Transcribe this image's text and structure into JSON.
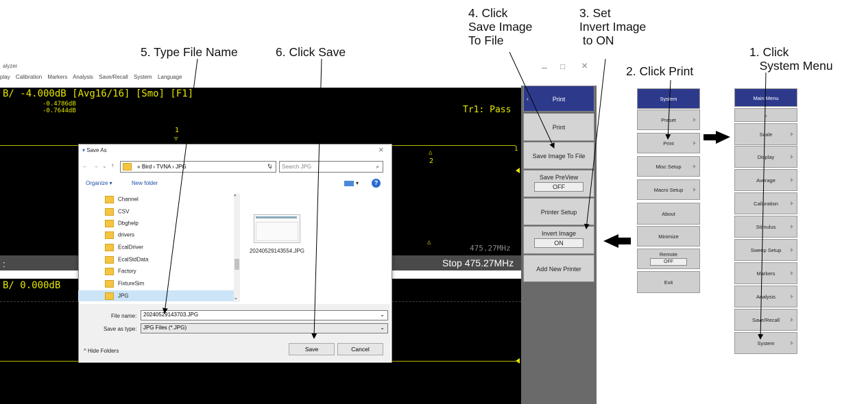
{
  "callouts": {
    "step1": "1. Click\n   System Menu",
    "step2": "2. Click Print",
    "step3": "3. Set\nInvert Image\n to ON",
    "step4": "4. Click\nSave Image\nTo File",
    "step5": "5. Type File Name",
    "step6": "6. Click Save"
  },
  "app": {
    "title": "alyzer",
    "menus": [
      "play",
      "Calibration",
      "Markers",
      "Analysis",
      "Save/Recall",
      "System",
      "Language"
    ],
    "window_controls": {
      "minimize": "–",
      "maximize": "□",
      "close": "×"
    }
  },
  "trace1": {
    "header": "B/ -4.000dB [Avg16/16] [Smo]   [F1]",
    "marker_val1": "-0.4786dB",
    "marker_val2": "-0.7644dB",
    "marker1_label": "1",
    "marker2_label": "2",
    "pass_label": "Tr1: Pass",
    "freq_label": "475.27MHz",
    "start_label": ":",
    "stop_label": "Stop 475.27MHz"
  },
  "trace2": {
    "header": "B/ 0.000dB"
  },
  "print_menu": {
    "title": "Print",
    "items": [
      {
        "label": "Print"
      },
      {
        "label": "Save Image To File"
      },
      {
        "label": "Save PreView",
        "value": "OFF"
      },
      {
        "label": "Printer Setup"
      },
      {
        "label": "Invert Image",
        "value": "ON"
      },
      {
        "label": "Add New Printer"
      }
    ]
  },
  "system_menu": {
    "title": "System",
    "items": [
      {
        "label": "Preset"
      },
      {
        "label": "Print"
      },
      {
        "label": "Misc Setup"
      },
      {
        "label": "Macro Setup"
      },
      {
        "label": "About"
      },
      {
        "label": "Minimize"
      },
      {
        "label": "Remote",
        "value": "OFF"
      },
      {
        "label": "Exit"
      }
    ]
  },
  "main_menu": {
    "title": "Main Menu",
    "items": [
      {
        "label": "Scale"
      },
      {
        "label": "Display"
      },
      {
        "label": "Average"
      },
      {
        "label": "Calibration"
      },
      {
        "label": "Stimulus"
      },
      {
        "label": "Sweep Setup"
      },
      {
        "label": "Markers"
      },
      {
        "label": "Analysis"
      },
      {
        "label": "Save/Recall"
      },
      {
        "label": "System"
      }
    ]
  },
  "save_dialog": {
    "title": "Save As",
    "breadcrumb": [
      "«",
      "Bird",
      "TVNA",
      "JPG"
    ],
    "search_placeholder": "Search JPG",
    "organize": "Organize ▾",
    "new_folder": "New folder",
    "folders": [
      "Channel",
      "CSV",
      "Dbghelp",
      "drivers",
      "EcalDriver",
      "EcalStdData",
      "Factory",
      "FixtureSim",
      "JPG"
    ],
    "file_item_name": "20240529143554.JPG",
    "file_name_label": "File name:",
    "file_name_value": "20240529143703.JPG",
    "save_type_label": "Save as type:",
    "save_type_value": "JPG Files (*.JPG)",
    "hide_folders": "Hide Folders",
    "save_button": "Save",
    "cancel_button": "Cancel"
  },
  "colors": {
    "trace": "#e6e600",
    "softkey_title": "#2d3a8c",
    "screen_bg": "#000000"
  }
}
